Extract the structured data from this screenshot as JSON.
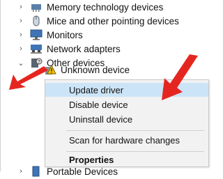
{
  "device_tree": {
    "items": [
      {
        "label": "Memory technology devices",
        "icon": "memory-icon",
        "chevron": "›"
      },
      {
        "label": "Mice and other pointing devices",
        "icon": "mouse-icon",
        "chevron": "›"
      },
      {
        "label": "Monitors",
        "icon": "monitor-icon",
        "chevron": "›"
      },
      {
        "label": "Network adapters",
        "icon": "network-icon",
        "chevron": "›"
      },
      {
        "label": "Other devices",
        "icon": "other-devices-icon",
        "chevron": "⌄"
      },
      {
        "label": "Unknown device",
        "icon": "unknown-device-warning-icon"
      },
      {
        "label": "Portable Devices",
        "icon": "portable-devices-icon",
        "chevron": "›"
      }
    ]
  },
  "context_menu": {
    "items": [
      {
        "label": "Update driver",
        "highlighted": true
      },
      {
        "label": "Disable device"
      },
      {
        "label": "Uninstall device"
      },
      {
        "label": "Scan for hardware changes"
      },
      {
        "label": "Properties",
        "bold": true
      }
    ]
  },
  "colors": {
    "arrow": "#e52620",
    "highlight": "#cce4f7",
    "menu_bg": "#f2f2f2",
    "warning": "#f5c400"
  }
}
